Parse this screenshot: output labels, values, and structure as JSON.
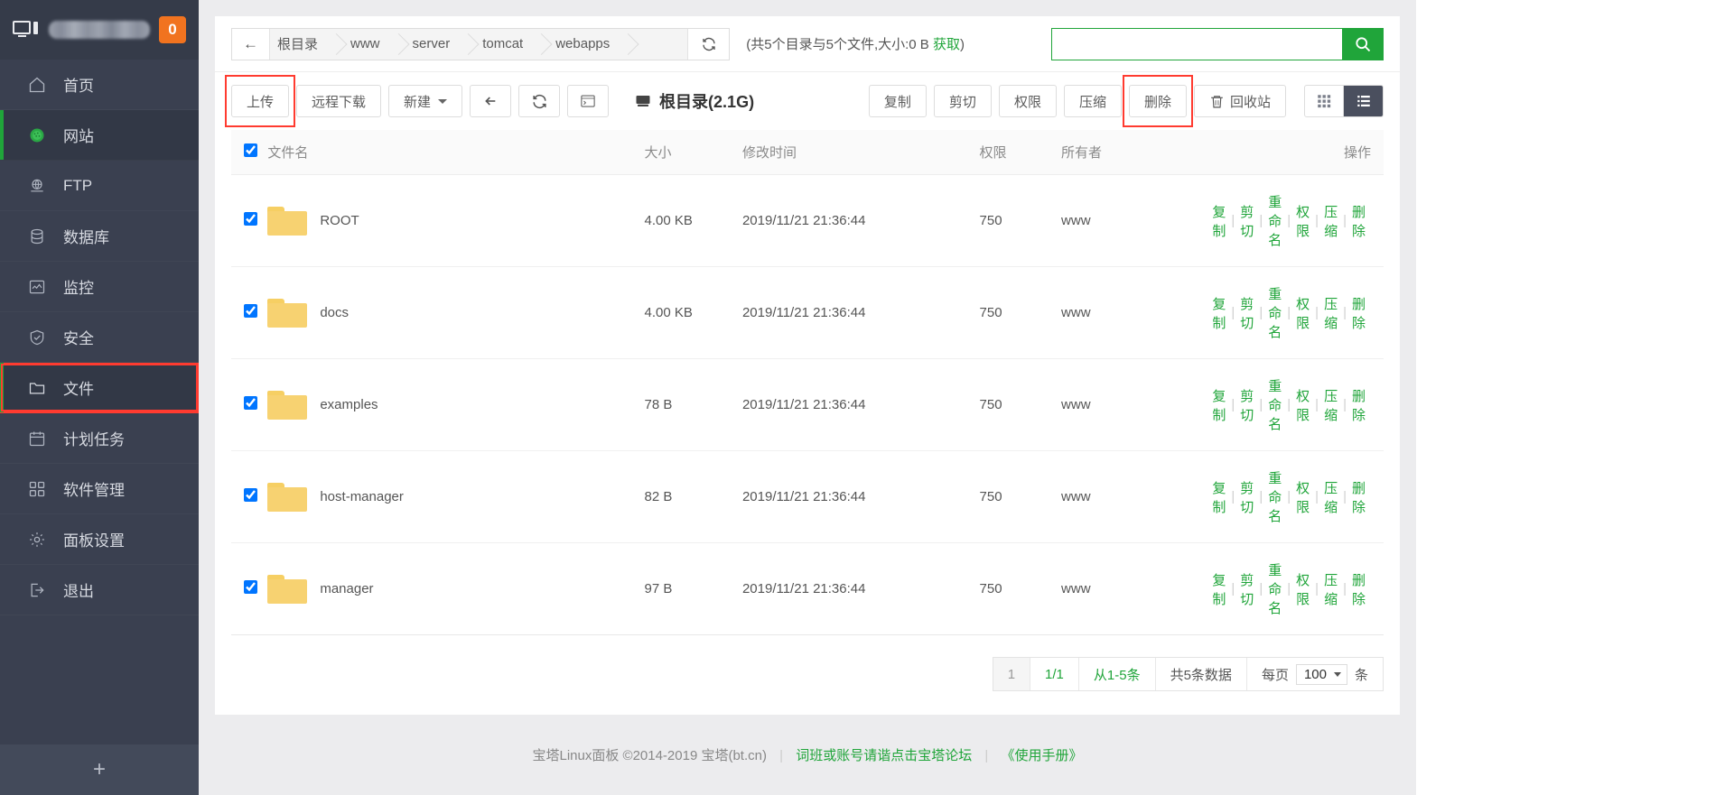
{
  "sidebar": {
    "brand": {
      "badge": "0"
    },
    "items": [
      {
        "label": "首页",
        "icon": "home-icon",
        "state": "normal"
      },
      {
        "label": "网站",
        "icon": "globe-icon",
        "state": "active"
      },
      {
        "label": "FTP",
        "icon": "ftp-icon",
        "state": "normal"
      },
      {
        "label": "数据库",
        "icon": "database-icon",
        "state": "normal"
      },
      {
        "label": "监控",
        "icon": "chart-icon",
        "state": "normal"
      },
      {
        "label": "安全",
        "icon": "shield-icon",
        "state": "normal"
      },
      {
        "label": "文件",
        "icon": "folder-icon",
        "state": "highlighted"
      },
      {
        "label": "计划任务",
        "icon": "calendar-icon",
        "state": "normal"
      },
      {
        "label": "软件管理",
        "icon": "apps-icon",
        "state": "normal"
      },
      {
        "label": "面板设置",
        "icon": "gear-icon",
        "state": "normal"
      },
      {
        "label": "退出",
        "icon": "logout-icon",
        "state": "normal"
      }
    ],
    "add_label": "+"
  },
  "breadcrumb": {
    "back": "←",
    "items": [
      "根目录",
      "www",
      "server",
      "tomcat",
      "webapps"
    ],
    "refresh_icon": "refresh-icon"
  },
  "dir_info": {
    "text": "(共5个目录与5个文件,大小:0 B ",
    "link": "获取",
    "suffix": ")"
  },
  "search": {
    "value": "",
    "placeholder": "",
    "button_icon": "search-icon"
  },
  "toolbar": {
    "upload": "上传",
    "remote_download": "远程下载",
    "new": "新建",
    "back_icon": "back-arrow-icon",
    "refresh_icon": "refresh-icon",
    "terminal_icon": "terminal-icon",
    "title": "根目录(2.1G)",
    "title_icon": "disk-icon",
    "copy": "复制",
    "cut": "剪切",
    "permission": "权限",
    "compress": "压缩",
    "delete": "删除",
    "recycle": "回收站",
    "recycle_icon": "trash-icon",
    "view_grid_icon": "grid-view-icon",
    "view_list_icon": "list-view-icon"
  },
  "table": {
    "headers": [
      "文件名",
      "大小",
      "修改时间",
      "权限",
      "所有者",
      "操作"
    ],
    "select_all": true,
    "row_actions": [
      "复制",
      "剪切",
      "重命名",
      "权限",
      "压缩",
      "删除"
    ],
    "rows": [
      {
        "checked": true,
        "name": "ROOT",
        "size": "4.00 KB",
        "mtime": "2019/11/21 21:36:44",
        "perm": "750",
        "owner": "www"
      },
      {
        "checked": true,
        "name": "docs",
        "size": "4.00 KB",
        "mtime": "2019/11/21 21:36:44",
        "perm": "750",
        "owner": "www"
      },
      {
        "checked": true,
        "name": "examples",
        "size": "78 B",
        "mtime": "2019/11/21 21:36:44",
        "perm": "750",
        "owner": "www"
      },
      {
        "checked": true,
        "name": "host-manager",
        "size": "82 B",
        "mtime": "2019/11/21 21:36:44",
        "perm": "750",
        "owner": "www"
      },
      {
        "checked": true,
        "name": "manager",
        "size": "97 B",
        "mtime": "2019/11/21 21:36:44",
        "perm": "750",
        "owner": "www"
      }
    ]
  },
  "pagination": {
    "page_number": "1",
    "page_of": "1/1",
    "range": "从1-5条",
    "total": "共5条数据",
    "per_page_label": "每页",
    "per_page_value": "100",
    "per_page_unit": "条"
  },
  "footer": {
    "brand": "宝塔Linux面板 ©2014-2019 宝塔(bt.cn)",
    "link1": "词班或账号请谐点击宝塔论坛",
    "link2": "《使用手册》"
  },
  "colors": {
    "accent_green": "#20a53a",
    "sidebar_bg": "#3a4050",
    "badge_orange": "#f1731f",
    "highlight_red": "#ff3b30",
    "folder_yellow": "#f7d271"
  }
}
